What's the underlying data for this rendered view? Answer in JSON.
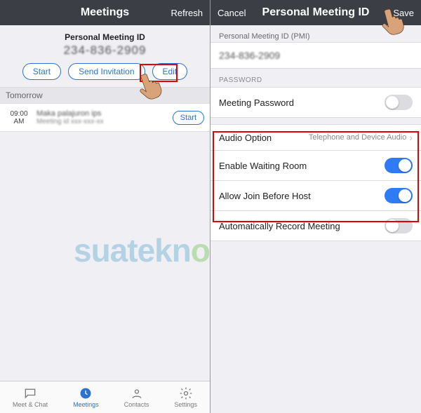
{
  "left": {
    "header": {
      "title": "Meetings",
      "refresh": "Refresh"
    },
    "pmi": {
      "label": "Personal Meeting ID",
      "value": "234-836-2909"
    },
    "buttons": {
      "start": "Start",
      "send": "Send Invitation",
      "edit": "Edit"
    },
    "sectionTomorrow": "Tomorrow",
    "meeting": {
      "time": "09:00",
      "ampm": "AM",
      "title": "Maka palajuron ips",
      "sub": "Meeting id xxx-xxx-xx",
      "start": "Start"
    },
    "tabs": {
      "chat": "Meet & Chat",
      "meetings": "Meetings",
      "contacts": "Contacts",
      "settings": "Settings"
    }
  },
  "right": {
    "header": {
      "cancel": "Cancel",
      "title": "Personal Meeting ID",
      "save": "Save"
    },
    "pmiLabel": "Personal Meeting ID (PMI)",
    "pmiValue": "234-836-2909",
    "passwordSection": "PASSWORD",
    "meetingPasswordLabel": "Meeting Password",
    "audioOption": {
      "label": "Audio Option",
      "value": "Telephone and Device Audio"
    },
    "waitingRoom": "Enable Waiting Room",
    "joinBeforeHost": "Allow Join Before Host",
    "autoRecord": "Automatically Record Meeting"
  },
  "watermark": "suatekno"
}
